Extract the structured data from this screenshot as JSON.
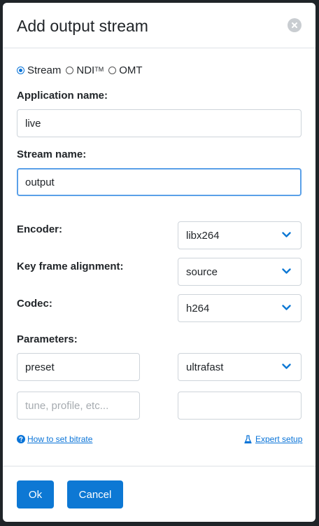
{
  "dialog": {
    "title": "Add output stream",
    "close_icon": "close-icon"
  },
  "stream_type": {
    "options": [
      {
        "label": "Stream",
        "selected": true
      },
      {
        "label": "NDI",
        "superscript": "TM",
        "selected": false
      },
      {
        "label": "OMT",
        "selected": false
      }
    ]
  },
  "form": {
    "application_name_label": "Application name:",
    "application_name_value": "live",
    "stream_name_label": "Stream name:",
    "stream_name_value": "output",
    "encoder_label": "Encoder:",
    "encoder_value": "libx264",
    "keyframe_label": "Key frame alignment:",
    "keyframe_value": "source",
    "codec_label": "Codec:",
    "codec_value": "h264",
    "parameters_label": "Parameters:",
    "param1_name": "preset",
    "param1_value": "ultrafast",
    "param2_name_placeholder": "tune, profile, etc...",
    "param2_value": ""
  },
  "links": {
    "bitrate_help": "How to set bitrate",
    "expert_setup": "Expert setup"
  },
  "footer": {
    "ok_label": "Ok",
    "cancel_label": "Cancel"
  },
  "colors": {
    "accent": "#0d78d4",
    "link": "#0a74d8",
    "focus_border": "#5aa0e8"
  }
}
